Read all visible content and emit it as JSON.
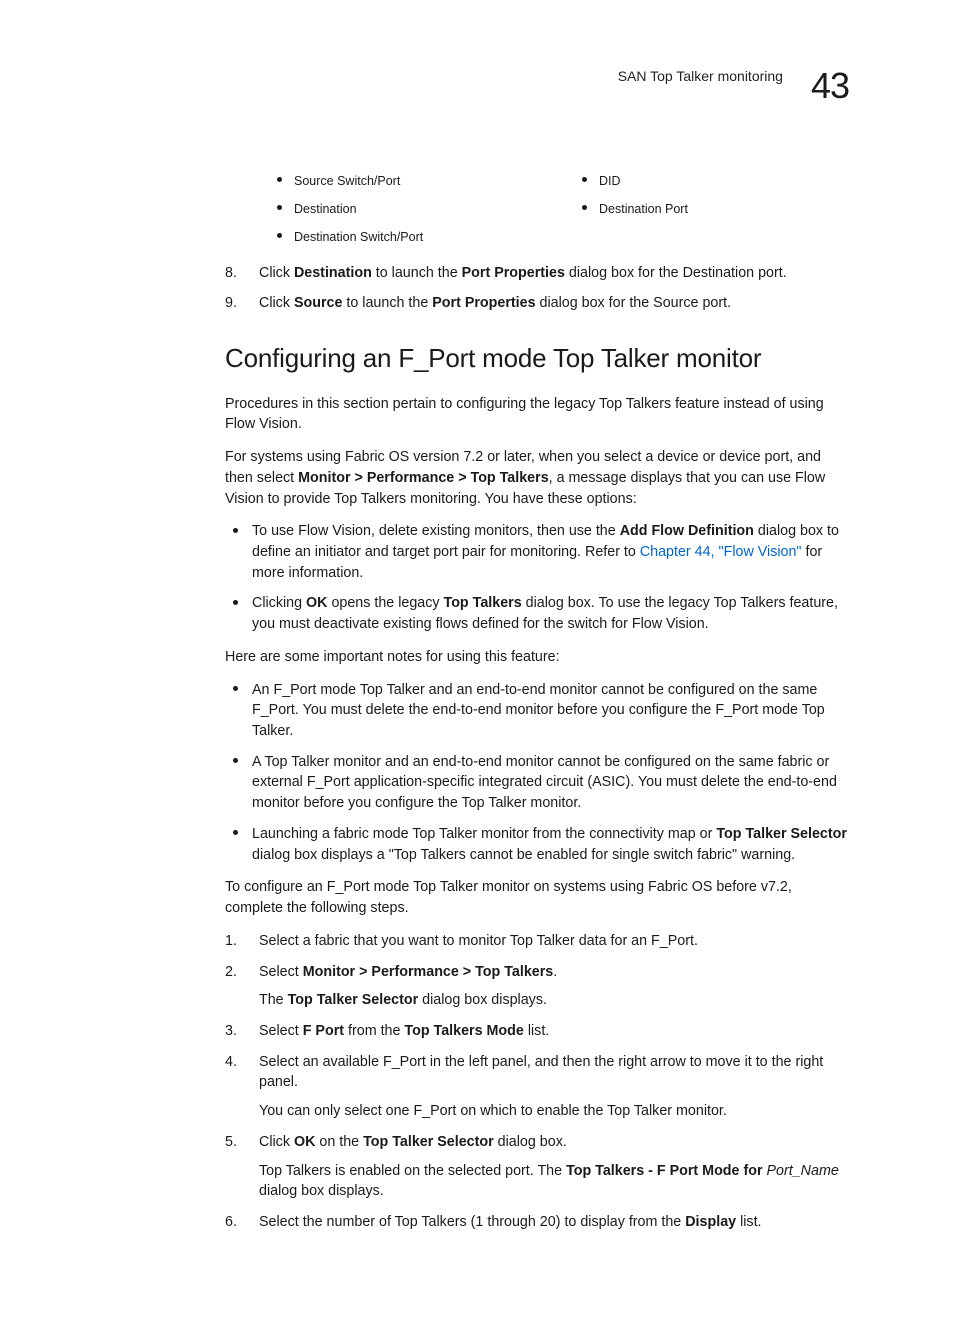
{
  "header": {
    "section_title": "SAN Top Talker monitoring",
    "chapter_number": "43"
  },
  "top_lists": {
    "left": [
      "Source Switch/Port",
      "Destination",
      "Destination Switch/Port"
    ],
    "right": [
      "DID",
      "Destination Port"
    ]
  },
  "steps_8_9": [
    {
      "num": "8.",
      "parts": [
        "Click ",
        {
          "b": "Destination"
        },
        " to launch the ",
        {
          "b": "Port Properties"
        },
        " dialog box for the Destination port."
      ]
    },
    {
      "num": "9.",
      "parts": [
        "Click ",
        {
          "b": "Source"
        },
        " to launch the ",
        {
          "b": "Port Properties"
        },
        " dialog box for the Source port."
      ]
    }
  ],
  "section": {
    "title": "Configuring an F_Port mode Top Talker monitor",
    "intro1": "Procedures in this section pertain to configuring the legacy Top Talkers feature instead of using Flow Vision.",
    "intro2_parts": [
      "For systems using Fabric OS version 7.2 or later, when you select a device or device port, and then select ",
      {
        "b": "Monitor > Performance > Top Talkers"
      },
      ", a message displays that you can use Flow Vision to provide Top Talkers monitoring. You have these options:"
    ],
    "options": [
      [
        "To use Flow Vision, delete existing monitors, then use the ",
        {
          "b": "Add Flow Definition"
        },
        " dialog box to define an initiator and target port pair for monitoring. Refer to ",
        {
          "link": "Chapter 44, \"Flow Vision\""
        },
        " for more information."
      ],
      [
        "Clicking ",
        {
          "b": "OK"
        },
        " opens the legacy ",
        {
          "b": "Top Talkers"
        },
        " dialog box. To use the legacy Top Talkers feature, you must deactivate existing flows defined for the switch for Flow Vision."
      ]
    ],
    "notes_intro": "Here are some important notes for using this feature:",
    "notes": [
      [
        "An F_Port mode Top Talker and an end-to-end monitor cannot be configured on the same F_Port. You must delete the end-to-end monitor before you configure the F_Port mode Top Talker."
      ],
      [
        "A Top Talker monitor and an end-to-end monitor cannot be configured on the same fabric or external F_Port application-specific integrated circuit (ASIC). You must delete the end-to-end monitor before you configure the Top Talker monitor."
      ],
      [
        "Launching a fabric mode Top Talker monitor from the connectivity map or ",
        {
          "b": "Top Talker Selector"
        },
        " dialog box displays a \"Top Talkers cannot be enabled for single switch fabric\" warning."
      ]
    ],
    "pre_steps": "To configure an F_Port mode Top Talker monitor on systems using Fabric OS before v7.2, complete the following steps.",
    "steps": [
      {
        "num": "1.",
        "lines": [
          [
            "Select a fabric that you want to monitor Top Talker data for an F_Port."
          ]
        ]
      },
      {
        "num": "2.",
        "lines": [
          [
            "Select ",
            {
              "b": "Monitor > Performance > Top Talkers"
            },
            "."
          ],
          [
            "The ",
            {
              "b": "Top Talker Selector"
            },
            " dialog box displays."
          ]
        ]
      },
      {
        "num": "3.",
        "lines": [
          [
            "Select ",
            {
              "b": "F Port"
            },
            " from the ",
            {
              "b": "Top Talkers Mode"
            },
            " list."
          ]
        ]
      },
      {
        "num": "4.",
        "lines": [
          [
            "Select an available F_Port in the left panel, and then the right arrow to move it to the right panel."
          ],
          [
            "You can only select one F_Port on which to enable the Top Talker monitor."
          ]
        ]
      },
      {
        "num": "5.",
        "lines": [
          [
            "Click ",
            {
              "b": "OK"
            },
            " on the ",
            {
              "b": "Top Talker Selector"
            },
            " dialog box."
          ],
          [
            "Top Talkers is enabled on the selected port. The ",
            {
              "b": "Top Talkers - F Port Mode for "
            },
            {
              "i": "Port_Name"
            },
            " dialog box displays."
          ]
        ]
      },
      {
        "num": "6.",
        "lines": [
          [
            "Select the number of Top Talkers (1 through 20) to display from the ",
            {
              "b": "Display"
            },
            " list."
          ]
        ]
      }
    ]
  }
}
